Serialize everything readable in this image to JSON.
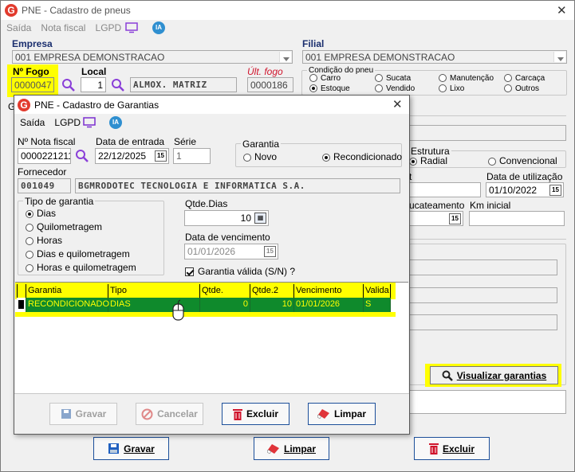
{
  "main": {
    "title": "PNE - Cadastro de pneus",
    "close": "✕",
    "menu": [
      "Saída",
      "Nota fiscal",
      "LGPD"
    ],
    "ia": "IA",
    "empresa_label": "Empresa",
    "empresa_value": "001 EMPRESA DEMONSTRACAO",
    "filial_label": "Filial",
    "filial_value": "001 EMPRESA DEMONSTRACAO",
    "fogo_label": "Nº  Fogo",
    "fogo_value": "0000047",
    "local_label": "Local",
    "local_value": "1",
    "local_desc": "ALMOX. MATRIZ",
    "ult_fogo_label": "Últ. fogo",
    "ult_fogo_value": "0000186",
    "condicao_label": "Condição do pneu",
    "condicao_options": [
      "Carro",
      "Sucata",
      "Manutenção",
      "Carcaça",
      "Estoque",
      "Vendido",
      "Lixo",
      "Outros"
    ],
    "estrutura_label": "Estrutura",
    "estrutura_radial": "Radial",
    "estrutura_conv": "Convencional",
    "t_label": "t",
    "data_util_label": "Data de utilização",
    "data_util_value": "01/10/2022",
    "sucateamento_label": "ucateamento",
    "km_inicial_label": "Km inicial",
    "g_label": "G",
    "visualizar_btn": "Visualizar garantias",
    "gravar_btn": "Gravar",
    "limpar_btn": "Limpar",
    "excluir_btn": "Excluir"
  },
  "dialog": {
    "title": "PNE - Cadastro de Garantias",
    "close": "✕",
    "menu": [
      "Saída",
      "LGPD"
    ],
    "ia": "IA",
    "nota_label": "Nº Nota fiscal",
    "nota_value": "0000221211",
    "data_entrada_label": "Data de entrada",
    "data_entrada_value": "22/12/2025",
    "serie_label": "Série",
    "serie_value": "1",
    "garantia_label": "Garantia",
    "garantia_novo": "Novo",
    "garantia_recond": "Recondicionado",
    "fornecedor_label": "Fornecedor",
    "fornecedor_code": "001049",
    "fornecedor_name": "BGMRODOTEC TECNOLOGIA E INFORMATICA S.A.",
    "tipo_label": "Tipo de garantia",
    "tipo_options": [
      "Dias",
      "Quilometragem",
      "Horas",
      "Dias e quilometragem",
      "Horas e quilometragem"
    ],
    "qtde_dias_label": "Qtde.Dias",
    "qtde_dias_value": "10",
    "vencimento_label": "Data de vencimento",
    "vencimento_value": "01/01/2026",
    "valida_label": "Garantia válida (S/N) ?",
    "grid_headers": [
      "Garantia",
      "Tipo",
      "Qtde.",
      "Qtde.2",
      "Vencimento",
      "Valida"
    ],
    "grid_rows": [
      [
        "RECONDICIONADO",
        "DIAS",
        "0",
        "10",
        "01/01/2026",
        "S"
      ]
    ],
    "gravar_btn": "Gravar",
    "cancelar_btn": "Cancelar",
    "excluir_btn": "Excluir",
    "limpar_btn": "Limpar"
  },
  "colors": {
    "highlight": "#ffff00",
    "grid_row": "#0f8a2c",
    "accent": "#d0142c",
    "purple": "#7a2fd0"
  }
}
